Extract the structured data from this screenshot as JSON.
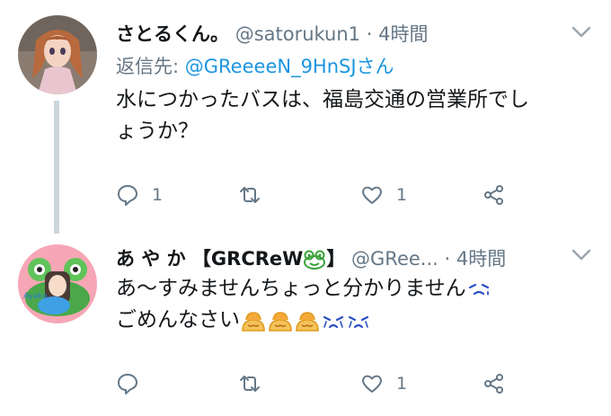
{
  "tweets": [
    {
      "name": "さとるくん。",
      "handle": "@satorukun1",
      "separator": "·",
      "time": "4時間",
      "reply_prefix": "返信先:",
      "reply_handle": "@GReeeeN_9HnSJさん",
      "text_line1": "水につかったバスは、福島交通の営業所でし",
      "text_line2": "ょうか？",
      "reply_count": "1",
      "retweet_count": "",
      "like_count": "1",
      "avatar_icon": "doll-avatar",
      "caret_icon": "chevron-down-icon"
    },
    {
      "name": "あ や か 【GRCReW",
      "name_suffix": "】",
      "handle": "@GRee...",
      "separator": "·",
      "time": "4時間",
      "text_line1": "あ〜すみませんちょっと分かりません",
      "text_line2": "ごめんなさい",
      "reply_count": "",
      "retweet_count": "",
      "like_count": "1",
      "avatar_icon": "illustrated-avatar",
      "emoji_icons": [
        "frog-emoji",
        "sweat-emoji",
        "bowing-person-emoji",
        "crying-emoji"
      ],
      "caret_icon": "chevron-down-icon"
    }
  ],
  "colors": {
    "text": "#14171a",
    "muted": "#657786",
    "link": "#1b95e0",
    "thread_line": "#ccd6dd"
  }
}
